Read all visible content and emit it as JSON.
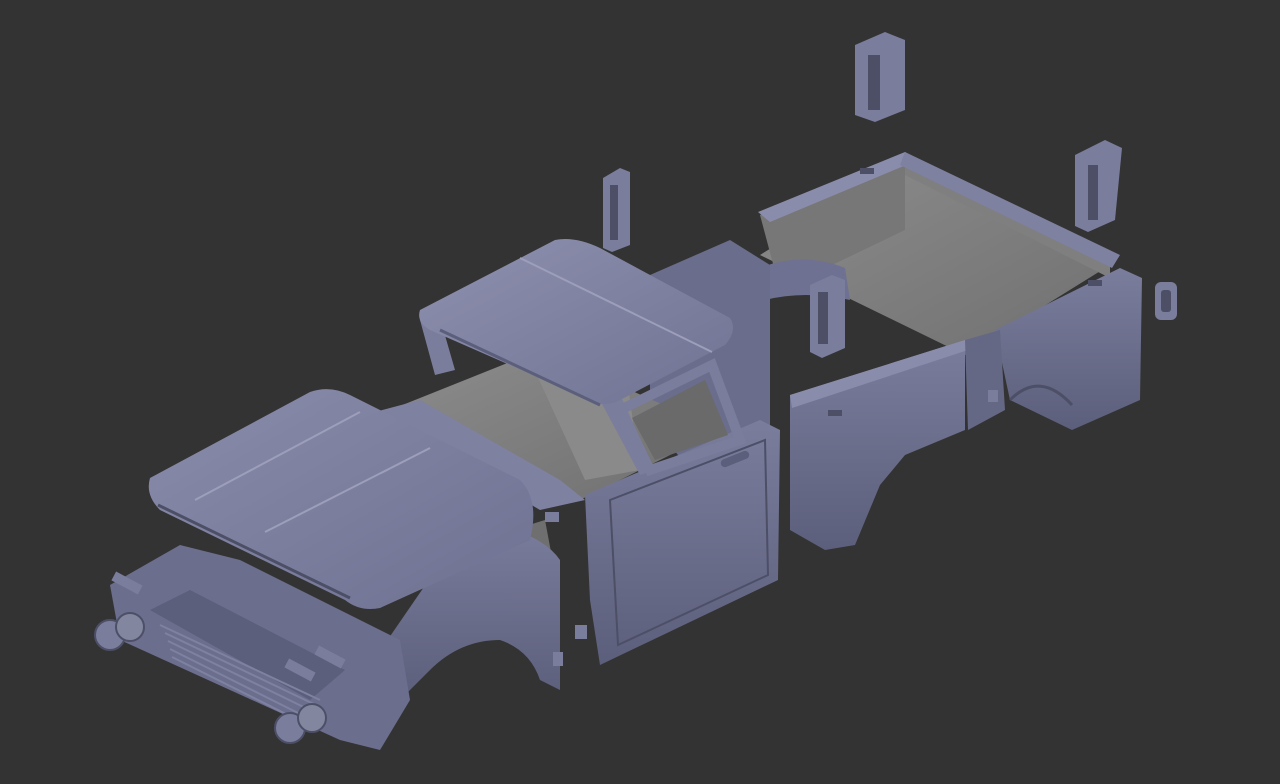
{
  "scene": {
    "background": "#333333",
    "model_color": "#6e7191",
    "model_light": "#8a8cab",
    "model_shadow": "#4d4f67",
    "interior": "#818181",
    "interior_dark": "#6a6a6a"
  }
}
